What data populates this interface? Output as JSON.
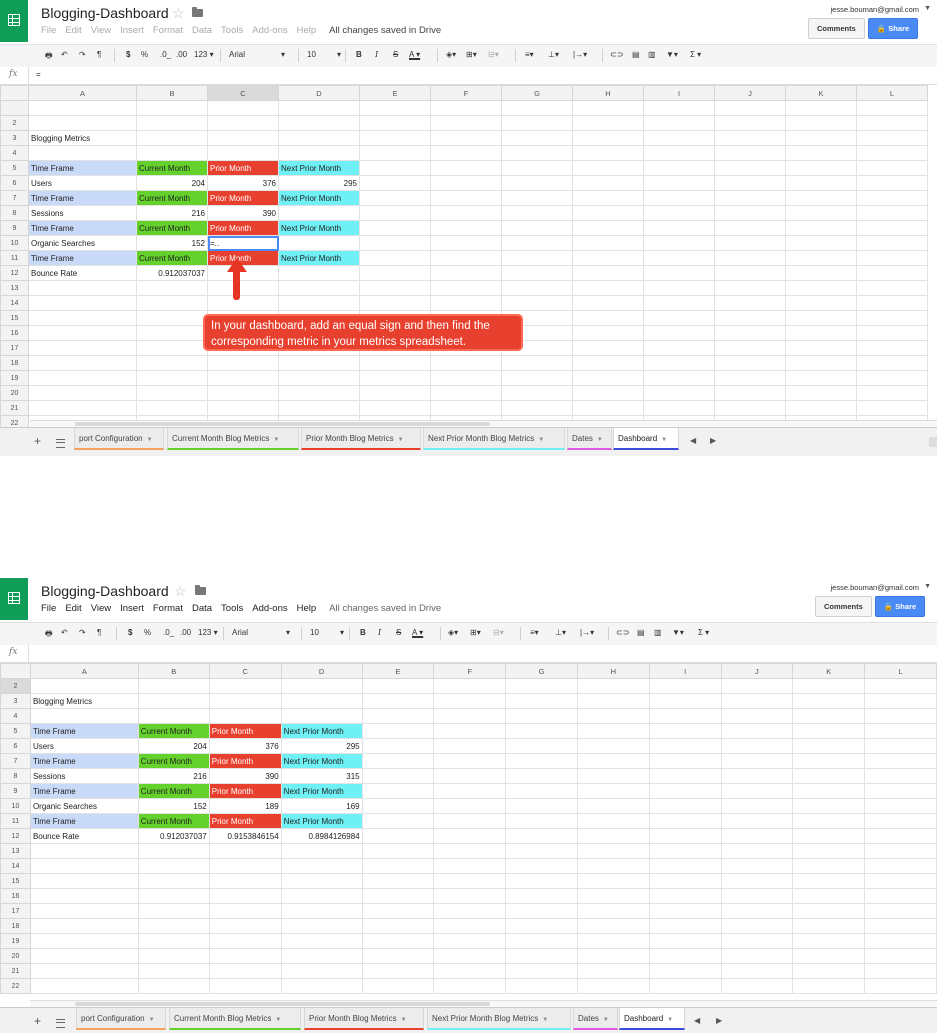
{
  "app": {
    "doc_title": "Blogging-Dashboard",
    "menu": [
      "File",
      "Edit",
      "View",
      "Insert",
      "Format",
      "Data",
      "Tools",
      "Add-ons",
      "Help"
    ],
    "save_status": "All changes saved in Drive",
    "email": "jesse.bouman@gmail.com",
    "comments_label": "Comments",
    "share_label": "Share",
    "fx_label": "fx"
  },
  "toolbar": {
    "currency": "$",
    "percent": "%",
    "dec_decrease": ".0_",
    "dec_increase": ".00",
    "more_formats": "123",
    "font": "Arial",
    "font_size": "10",
    "bold": "B",
    "italic": "I",
    "strike": "S",
    "text_color": "A",
    "sum": "Σ"
  },
  "columns": [
    "A",
    "B",
    "C",
    "D",
    "E",
    "F",
    "G",
    "H",
    "I",
    "J",
    "K",
    "L"
  ],
  "sheet_tabs": [
    "port Configuration",
    "Current Month Blog Metrics",
    "Prior Month Blog Metrics",
    "Next Prior Month Blog Metrics",
    "Dates",
    "Dashboard"
  ],
  "tab_colors": [
    "#f6a15b",
    "#64d12d",
    "#e8402f",
    "#6ef0f5",
    "#e05be0",
    "#3c4bdc"
  ],
  "labels": {
    "title": "Blogging Metrics",
    "time_frame": "Time Frame",
    "current_month": "Current Month",
    "prior_month": "Prior Month",
    "next_prior_month": "Next Prior Month",
    "users": "Users",
    "sessions": "Sessions",
    "organic_searches": "Organic Searches",
    "bounce_rate": "Bounce Rate"
  },
  "before": {
    "formula_bar": "=",
    "users": [
      "204",
      "376",
      "295"
    ],
    "sessions": [
      "216",
      "390",
      ""
    ],
    "organic": [
      "152",
      "=..",
      ""
    ],
    "bounce": [
      "0.912037037",
      "",
      ""
    ],
    "callout": "In your dashboard, add an equal sign and then find the corresponding metric in your metrics spreadsheet."
  },
  "after": {
    "formula_bar": "",
    "users": [
      "204",
      "376",
      "295"
    ],
    "sessions": [
      "216",
      "390",
      "315"
    ],
    "organic": [
      "152",
      "189",
      "169"
    ],
    "bounce": [
      "0.912037037",
      "0.9153846154",
      "0.8984126984"
    ]
  },
  "colors": {
    "header_blue": "#c9daf8",
    "current_green": "#64d12d",
    "prior_red": "#e8402f",
    "next_cyan": "#6ef0f5",
    "share_blue": "#4a8af4",
    "sheets_green": "#0f9d58"
  }
}
